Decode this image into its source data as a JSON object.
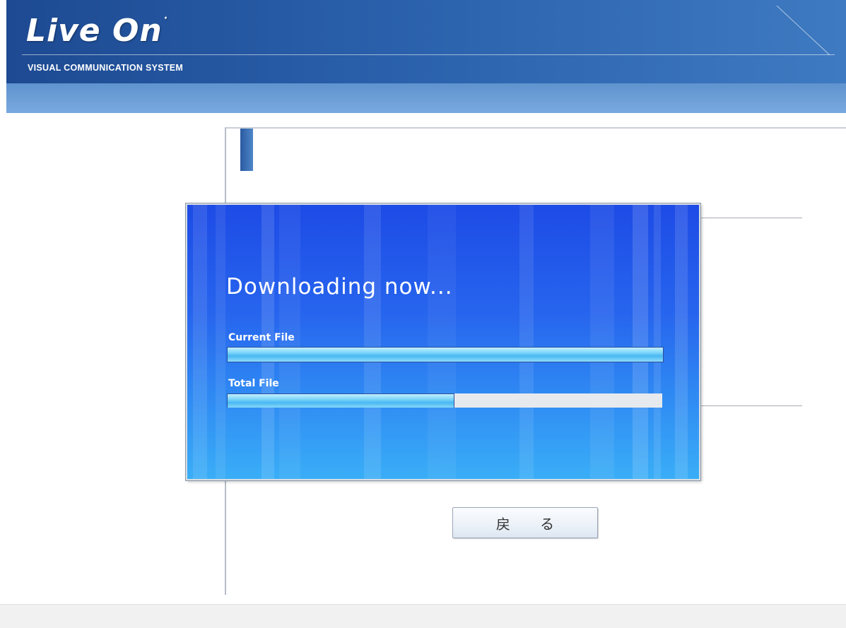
{
  "header": {
    "logo_text": "Live On",
    "tagline": "VISUAL COMMUNICATION SYSTEM"
  },
  "dialog": {
    "title": "Downloading now...",
    "bars": [
      {
        "label": "Current File",
        "progress": 1.0
      },
      {
        "label": "Total File",
        "progress": 0.52
      }
    ]
  },
  "buttons": {
    "back_label": "戻 る"
  },
  "colors": {
    "header": "#2a60ab",
    "dialog_top": "#1d4be6",
    "dialog_bottom": "#3aaef7",
    "progress_fill": "#7ed6fb"
  }
}
